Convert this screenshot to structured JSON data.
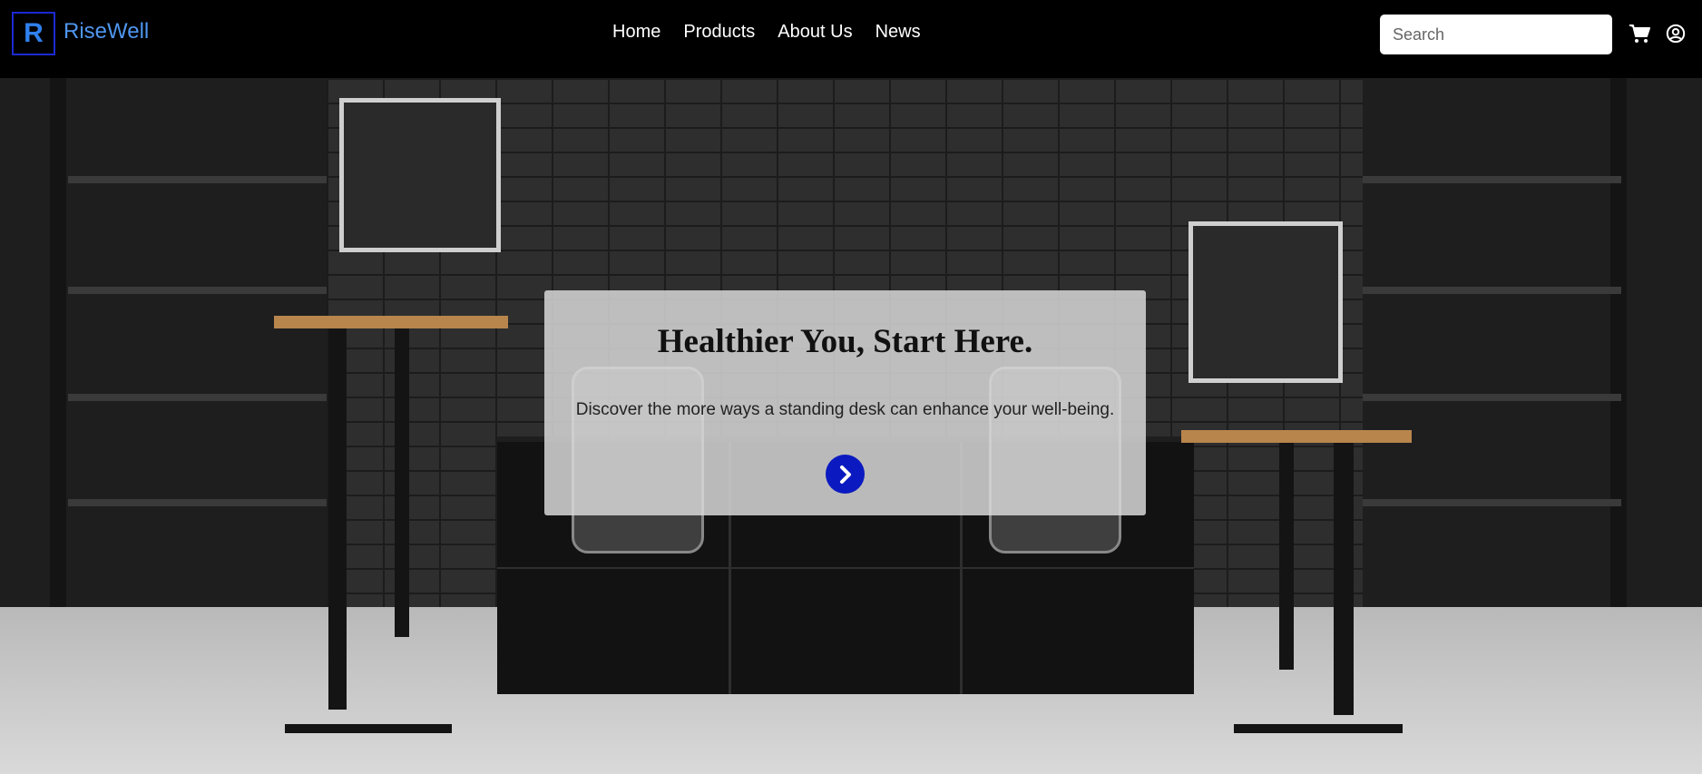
{
  "brand": {
    "logo_letter": "R",
    "name": "RiseWell"
  },
  "nav": {
    "items": [
      "Home",
      "Products",
      "About Us",
      "News"
    ]
  },
  "search": {
    "placeholder": "Search"
  },
  "icons": {
    "search": "search-icon",
    "cart": "cart-icon",
    "user": "user-circle-icon",
    "cta": "chevron-right-icon"
  },
  "hero": {
    "title": "Healthier You, Start Here.",
    "subtitle": "Discover the more ways a standing desk can enhance your well-being."
  },
  "colors": {
    "brand": "#4f96ef",
    "accent": "#0b1ac0",
    "header_bg": "#000000"
  }
}
